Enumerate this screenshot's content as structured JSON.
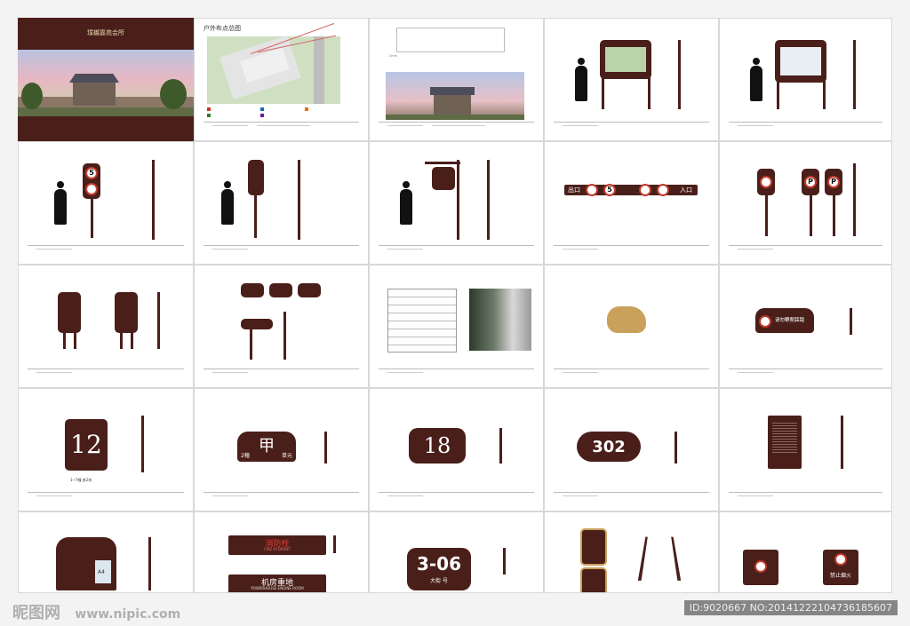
{
  "cover": {
    "title": "璞樾嘉苑会所"
  },
  "map": {
    "title": "户外布点总图"
  },
  "signs": {
    "speed": "5",
    "exit": "出口",
    "entrance": "入口",
    "p": "P",
    "climb": "请勿攀爬踩踏",
    "building_no": "12",
    "building_sub": "1~7幢  各2块",
    "unit_char": "甲",
    "unit_left": "2幢",
    "unit_right": "单元",
    "door_18": "18",
    "door_302": "302",
    "a4": "A4",
    "hydrant": "消防栓",
    "hydrant_en": "FIRE HYDRANT",
    "machine": "机房重地",
    "machine_en": "POWERHOUSE ENGINE ROOM",
    "room": "3-06",
    "room_sub": "大街    号",
    "no_smoke": "禁止烟火"
  },
  "watermark": {
    "left": "昵图网",
    "url": "www.nipic.com",
    "right": "ID:9020667 NO:20141222104736185607"
  },
  "colors": {
    "sign": "#4a1f1a",
    "red": "#c0392b",
    "gold": "#c9a15a"
  }
}
